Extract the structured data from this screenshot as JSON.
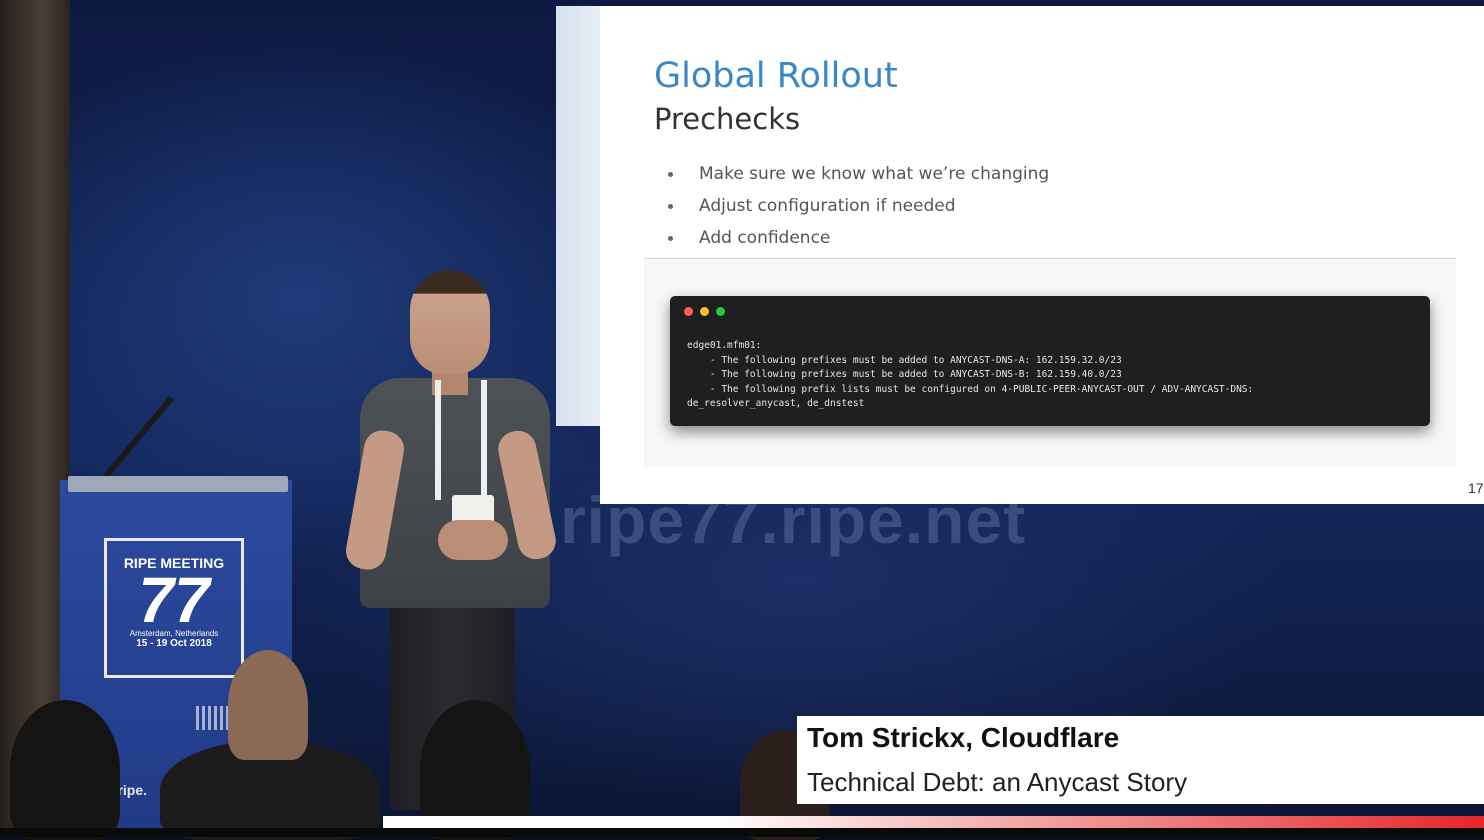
{
  "scene": {
    "watermark": "ripe77.ripe.net",
    "podium_sign": {
      "line1": "RIPE MEETING",
      "number": "77",
      "location": "Amsterdam, Netherlands",
      "dates": "15 - 19 Oct 2018"
    },
    "podium_url": "77.ripe."
  },
  "slide": {
    "title": "Global Rollout",
    "subtitle": "Prechecks",
    "bullets": [
      "Make sure we know what we’re changing",
      "Adjust configuration if needed",
      "Add confidence"
    ],
    "terminal_lines": [
      "edge01.mfm01:",
      "    - The following prefixes must be added to ANYCAST-DNS-A: 162.159.32.0/23",
      "    - The following prefixes must be added to ANYCAST-DNS-B: 162.159.40.0/23",
      "    - The following prefix lists must be configured on 4-PUBLIC-PEER-ANYCAST-OUT / ADV-ANYCAST-DNS:",
      "de_resolver_anycast, de_dnstest"
    ],
    "page_number": "17"
  },
  "lower_third": {
    "name": "Tom Strickx, Cloudflare",
    "talk_title": "Technical Debt: an Anycast Story"
  },
  "colors": {
    "slide_title": "#3b88c6",
    "stage_blue": "#13275c",
    "accent_red": "#e5252a"
  }
}
